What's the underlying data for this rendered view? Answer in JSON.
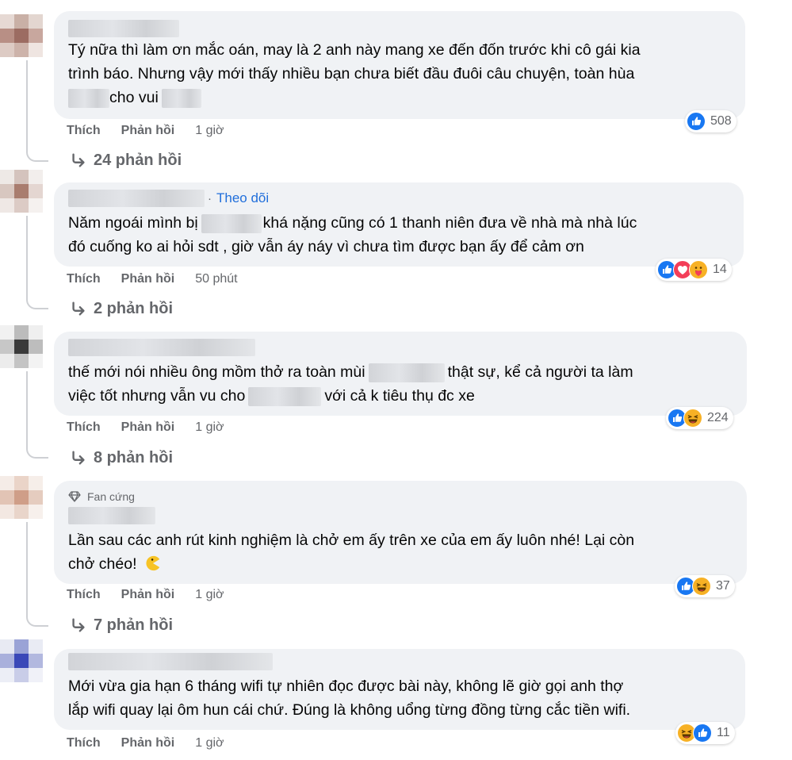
{
  "comments": [
    {
      "lines": [
        "Tý nữa thì làm ơn mắc oán, may là 2 anh này mang xe đến đốn trước khi cô gái kia",
        "trình báo. Nhưng vậy mới thấy nhiều bạn chưa biết đầu đuôi câu chuyện, toàn hùa",
        "cho vui"
      ],
      "like_label": "Thích",
      "reply_label": "Phản hồi",
      "time": "1 giờ",
      "reactions": [
        "like-icon"
      ],
      "reaction_count": "508",
      "replies_label": "24 phản hồi"
    },
    {
      "follow_label": "Theo dõi",
      "lines_a": [
        "Năm ngoái mình bị",
        "khá nặng cũng có 1 thanh niên đưa về nhà mà nhà lúc"
      ],
      "line_b": "đó cuống ko ai hỏi sdt , giờ vẫn áy náy vì chưa tìm được bạn ấy để cảm ơn",
      "like_label": "Thích",
      "reply_label": "Phản hồi",
      "time": "50 phút",
      "reactions": [
        "like-icon",
        "love-icon",
        "care-icon"
      ],
      "reaction_count": "14",
      "replies_label": "2 phản hồi"
    },
    {
      "lines_a": [
        "thế mới nói nhiều ông mồm thở ra toàn mùi",
        "thật sự, kể cả người ta làm"
      ],
      "lines_b": [
        "việc tốt nhưng vẫn vu cho",
        "với cả k tiêu thụ đc xe"
      ],
      "like_label": "Thích",
      "reply_label": "Phản hồi",
      "time": "1 giờ",
      "reactions": [
        "like-icon",
        "haha-icon"
      ],
      "reaction_count": "224",
      "replies_label": "8 phản hồi"
    },
    {
      "badge": "Fan cứng",
      "lines": [
        "Lần sau các anh rút kinh nghiệm là chở em ấy trên xe của em ấy luôn nhé! Lại còn",
        "chở chéo!"
      ],
      "like_label": "Thích",
      "reply_label": "Phản hồi",
      "time": "1 giờ",
      "reactions": [
        "like-icon",
        "haha-icon"
      ],
      "reaction_count": "37",
      "replies_label": "7 phản hồi"
    },
    {
      "lines": [
        "Mới vừa gia hạn 6 tháng wifi tự nhiên đọc được bài này, không lẽ giờ gọi anh thợ",
        "lắp wifi quay lại ôm hun cái chứ. Đúng là không uổng từng đồng từng cắc tiền wifi."
      ],
      "like_label": "Thích",
      "reply_label": "Phản hồi",
      "time": "1 giờ",
      "reactions": [
        "haha-icon",
        "like-icon"
      ],
      "reaction_count": "11"
    }
  ],
  "colors": {
    "like": "#1877f2",
    "love": "#f33e58",
    "haha": "#f7b125",
    "link": "#216fdb",
    "muted": "#65676b"
  }
}
